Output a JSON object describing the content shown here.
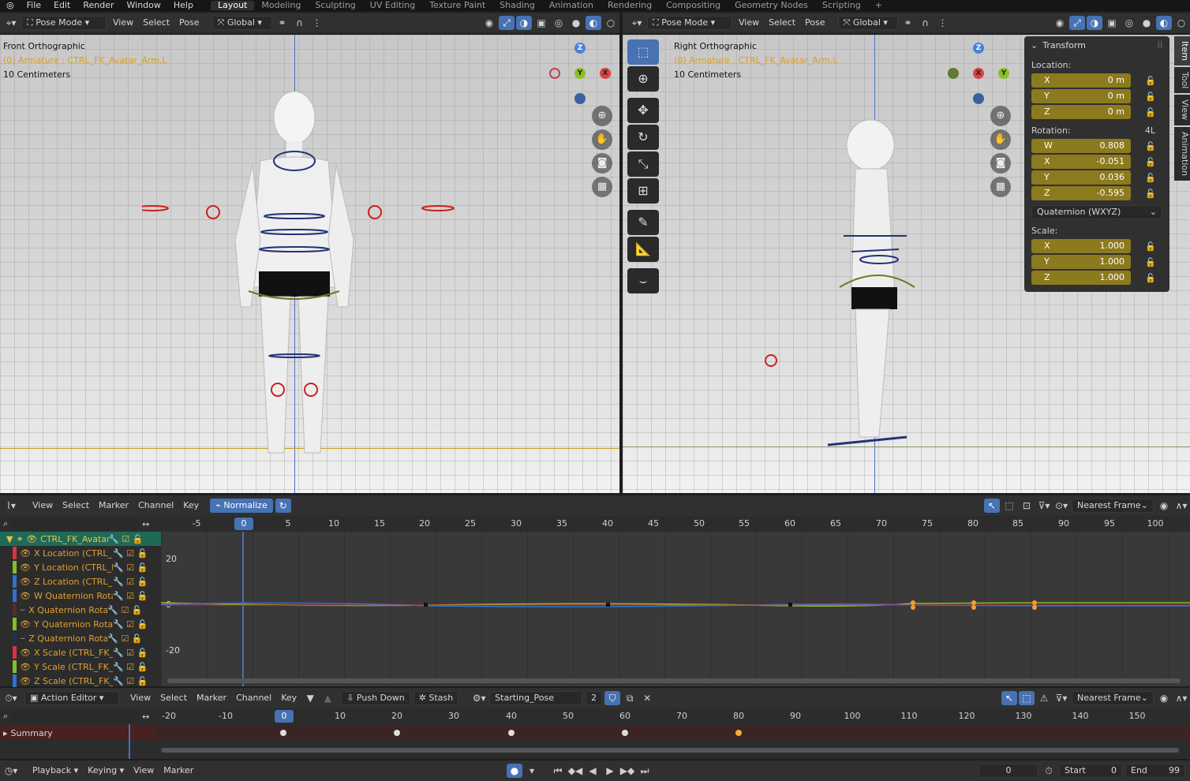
{
  "menus": [
    "File",
    "Edit",
    "Render",
    "Window",
    "Help"
  ],
  "workspaces": [
    "Layout",
    "Modeling",
    "Sculpting",
    "UV Editing",
    "Texture Paint",
    "Shading",
    "Animation",
    "Rendering",
    "Compositing",
    "Geometry Nodes",
    "Scripting"
  ],
  "active_workspace": "Layout",
  "left_view": {
    "mode": "Pose Mode",
    "menus": [
      "View",
      "Select",
      "Pose"
    ],
    "orientation": "Global",
    "title": "Front Orthographic",
    "object": "(0) Armature : CTRL_FK_Avatar_Arm.L",
    "scale": "10 Centimeters"
  },
  "right_view": {
    "mode": "Pose Mode",
    "menus": [
      "View",
      "Select",
      "Pose"
    ],
    "orientation": "Global",
    "title": "Right Orthographic",
    "object": "(0) Armature : CTRL_FK_Avatar_Arm.L",
    "scale": "10 Centimeters"
  },
  "transform": {
    "title": "Transform",
    "location_label": "Location:",
    "location": [
      {
        "axis": "X",
        "value": "0 m"
      },
      {
        "axis": "Y",
        "value": "0 m"
      },
      {
        "axis": "Z",
        "value": "0 m"
      }
    ],
    "rotation_label": "Rotation:",
    "rotation_mode_short": "4L",
    "rotation": [
      {
        "axis": "W",
        "value": "0.808"
      },
      {
        "axis": "X",
        "value": "-0.051"
      },
      {
        "axis": "Y",
        "value": "0.036"
      },
      {
        "axis": "Z",
        "value": "-0.595"
      }
    ],
    "rotation_mode": "Quaternion (WXYZ)",
    "scale_label": "Scale:",
    "scale": [
      {
        "axis": "X",
        "value": "1.000"
      },
      {
        "axis": "Y",
        "value": "1.000"
      },
      {
        "axis": "Z",
        "value": "1.000"
      }
    ]
  },
  "side_tabs": [
    "Item",
    "Tool",
    "View",
    "Animation"
  ],
  "graph_editor": {
    "menus": [
      "View",
      "Select",
      "Marker",
      "Channel",
      "Key"
    ],
    "normalize": "Normalize",
    "snap": "Nearest Frame",
    "current_frame": "0",
    "ruler": [
      "-5",
      "5",
      "10",
      "15",
      "20",
      "25",
      "30",
      "35",
      "40",
      "45",
      "50",
      "55",
      "60",
      "65",
      "70",
      "75",
      "80",
      "85",
      "90",
      "95",
      "100"
    ],
    "y_labels": [
      "20",
      "0",
      "-20"
    ],
    "channels": [
      {
        "name": "CTRL_FK_Avatar",
        "color": "#2a8a6a"
      },
      {
        "name": "X Location (CTRL_FI",
        "color": "#e03040"
      },
      {
        "name": "Y Location (CTRL_FI",
        "color": "#80c020"
      },
      {
        "name": "Z Location (CTRL_FI",
        "color": "#3070d0"
      },
      {
        "name": "W Quaternion Rotat",
        "color": "#3070d0"
      },
      {
        "name": "X Quaternion Rotati",
        "color": "#5a2a2a"
      },
      {
        "name": "Y Quaternion Rotati",
        "color": "#80c020"
      },
      {
        "name": "Z Quaternion Rotati",
        "color": "#203050"
      },
      {
        "name": "X Scale (CTRL_FK_A",
        "color": "#e03040"
      },
      {
        "name": "Y Scale (CTRL_FK_A",
        "color": "#80c020"
      },
      {
        "name": "Z Scale (CTRL_FK_A",
        "color": "#3070d0"
      }
    ]
  },
  "action_editor": {
    "mode": "Action Editor",
    "menus": [
      "View",
      "Select",
      "Marker",
      "Channel",
      "Key"
    ],
    "push_down": "Push Down",
    "stash": "Stash",
    "action": "Starting_Pose",
    "users": "2",
    "snap": "Nearest Frame",
    "current_frame": "0",
    "ruler": [
      "-20",
      "-10",
      "10",
      "20",
      "30",
      "40",
      "50",
      "60",
      "70",
      "80",
      "90",
      "100",
      "110",
      "120",
      "130",
      "140",
      "150"
    ],
    "summary": "Summary"
  },
  "timeline": {
    "menus": [
      "Playback",
      "Keying",
      "View",
      "Marker"
    ],
    "frame": "0",
    "start_label": "Start",
    "start": "0",
    "end_label": "End",
    "end": "99"
  }
}
